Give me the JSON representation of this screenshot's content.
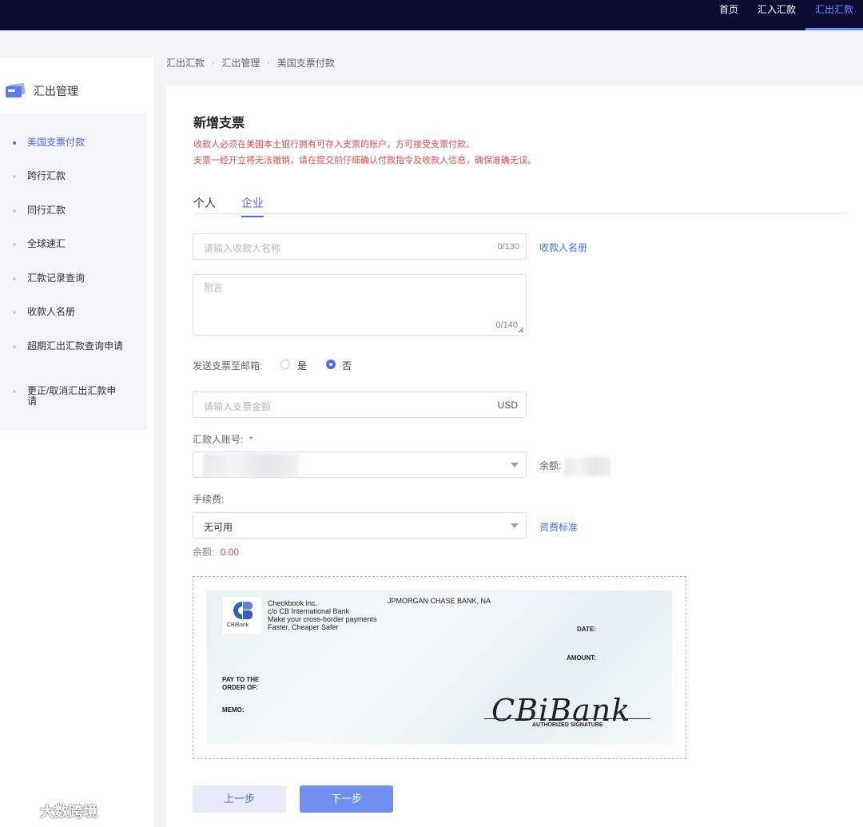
{
  "topnav": {
    "items": [
      "首页",
      "汇入汇款",
      "汇出汇款"
    ],
    "active_index": 2
  },
  "sidebar": {
    "title": "汇出管理",
    "items": [
      {
        "label": "美国支票付款",
        "active": true
      },
      {
        "label": "跨行汇款"
      },
      {
        "label": "同行汇款"
      },
      {
        "label": "全球速汇"
      },
      {
        "label": "汇款记录查询"
      },
      {
        "label": "收款人名册"
      },
      {
        "label": "超期汇出汇款查询申请"
      },
      {
        "label": "更正/取消汇出汇款申请"
      }
    ]
  },
  "breadcrumb": [
    "汇出汇款",
    "汇出管理",
    "美国支票付款"
  ],
  "form": {
    "title": "新增支票",
    "warnings": [
      "收款人必须在美国本土银行拥有可存入支票的账户，方可接受支票付款。",
      "支票一经开立将无法撤销，请在提交前仔细确认付款指令及收款人信息，确保准确无误。"
    ],
    "tabs": [
      "个人",
      "企业"
    ],
    "active_tab": 1,
    "payee": {
      "placeholder": "请输入收款人名称",
      "counter": "0/130",
      "link": "收款人名册"
    },
    "memo": {
      "placeholder": "附言",
      "counter": "0/140"
    },
    "email": {
      "label": "发送支票至邮箱:",
      "options": [
        "是",
        "否"
      ],
      "selected": 1
    },
    "amount": {
      "placeholder": "请输入支票金额",
      "currency": "USD"
    },
    "account": {
      "label": "汇款人账号:",
      "required_mark": "*",
      "balance_label": "余额:"
    },
    "fee": {
      "label": "手续费:",
      "value": "无可用",
      "link": "资费标准",
      "balance_label": "余额:",
      "balance_value": "0.00"
    },
    "buttons": {
      "prev": "上一步",
      "next": "下一步"
    }
  },
  "cheque": {
    "logo_text": "CBiBank",
    "issuer_lines": [
      "Checkbook Inc.",
      "c/o CB International Bank",
      "Make your cross-border payments",
      "Faster, Cheaper Safer"
    ],
    "bank": "JPMORGAN CHASE BANK, NA",
    "date_label": "DATE:",
    "amount_label": "AMOUNT:",
    "pay_to_line1": "PAY TO THE",
    "pay_to_line2": "ORDER OF:",
    "memo_label": "MEMO:",
    "signature_text": "CBiBank",
    "signature_caption": "AUTHORIZED SIGNATURE"
  },
  "watermark": {
    "text": "大数跨境"
  },
  "colors": {
    "accent": "#4a6cf7",
    "topbar": "#0b0b33",
    "warning": "#e34d4d"
  }
}
